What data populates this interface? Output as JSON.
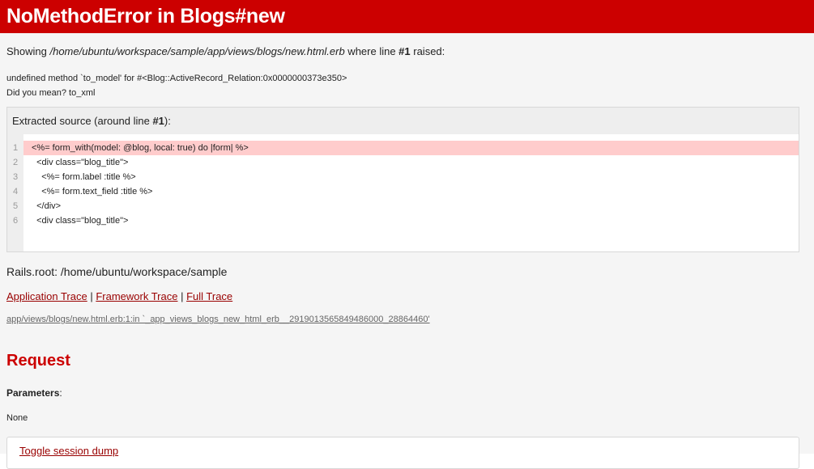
{
  "header": {
    "title": "NoMethodError in Blogs#new"
  },
  "showing": {
    "prefix": "Showing ",
    "path": "/home/ubuntu/workspace/sample/app/views/blogs/new.html.erb",
    "middle": " where line ",
    "line": "#1",
    "suffix": " raised:"
  },
  "error": {
    "message": "undefined method `to_model' for #<Blog::ActiveRecord_Relation:0x0000000373e350>",
    "suggestion": "Did you mean?  to_xml"
  },
  "source": {
    "title_prefix": "Extracted source (around line ",
    "title_line": "#1",
    "title_suffix": "):",
    "lines": [
      {
        "num": "1",
        "code": "<%= form_with(model: @blog, local: true) do |form| %>",
        "highlight": true
      },
      {
        "num": "2",
        "code": "  <div class=\"blog_title\">",
        "highlight": false
      },
      {
        "num": "3",
        "code": "    <%= form.label :title %>",
        "highlight": false
      },
      {
        "num": "4",
        "code": "    <%= form.text_field :title %>",
        "highlight": false
      },
      {
        "num": "5",
        "code": "  </div>",
        "highlight": false
      },
      {
        "num": "6",
        "code": "  <div class=\"blog_title\">",
        "highlight": false
      }
    ]
  },
  "rails_root": "Rails.root: /home/ubuntu/workspace/sample",
  "traces": {
    "application": "Application Trace",
    "framework": "Framework Trace",
    "full": "Full Trace",
    "separator": " | "
  },
  "trace_line": "app/views/blogs/new.html.erb:1:in `_app_views_blogs_new_html_erb__2919013565849486000_28864460'",
  "request": {
    "heading": "Request",
    "params_label": "Parameters",
    "params_colon": ":",
    "params_value": "None"
  },
  "toggle": {
    "label": "Toggle session dump"
  },
  "colors": {
    "accent": "#cc0000",
    "link": "#990000",
    "highlight": "#ffcccc"
  }
}
